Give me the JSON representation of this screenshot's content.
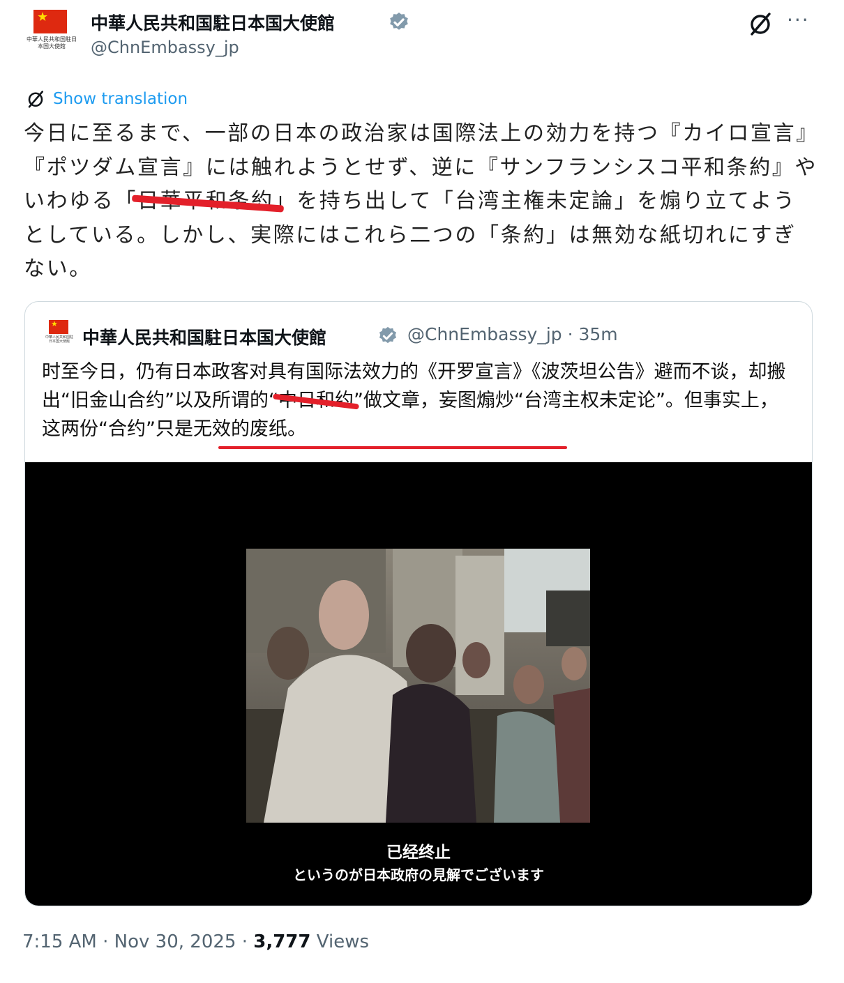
{
  "post": {
    "author_name": "中華人民共和国駐日本国大使館",
    "handle": "@ChnEmbassy_jp",
    "avatar_text": "中華人民共和国駐日本国大使館",
    "show_translation": "Show translation",
    "more_label": "···",
    "text": {
      "seg1": "今日に至るまで、一部の日本の政治家は国際法上の効力を持つ『カイロ宣言』『ポツダム宣言』には触れようとせず、逆に『サンフランシスコ平和条約』やいわゆる「",
      "redacted": "日華平和条約",
      "seg2": "」を持ち出して「台湾主権未定論」を煽り立てようとしている。しかし、実際にはこれら二つの「条約」は無効な紙切れにすぎない。"
    },
    "timestamp": "7:15 AM · Nov 30, 2025 · ",
    "views_count": "3,777",
    "views_label": " Views"
  },
  "quote": {
    "author_name": "中華人民共和国駐日本国大使館",
    "handle": "@ChnEmbassy_jp · 35m",
    "text": {
      "seg1": "时至今日，仍有日本政客对具有国际法效力的《开罗宣言》《波茨坦公告》避而不谈，却搬出“旧金山合约”以及所谓的“",
      "redacted": "中日和约",
      "seg2": "”做文章，妄图煽炒“台湾主权未定论”。但事实上，这两份“合约”只是无效的废纸。"
    },
    "video": {
      "subtitle_zh": "已经终止",
      "subtitle_ja": "というのが日本政府の見解でございます"
    }
  },
  "colors": {
    "accent_blue": "#1d9bf0",
    "strike_red": "#e3202a",
    "muted_gray": "#536471",
    "verified_gray": "#829aab"
  }
}
